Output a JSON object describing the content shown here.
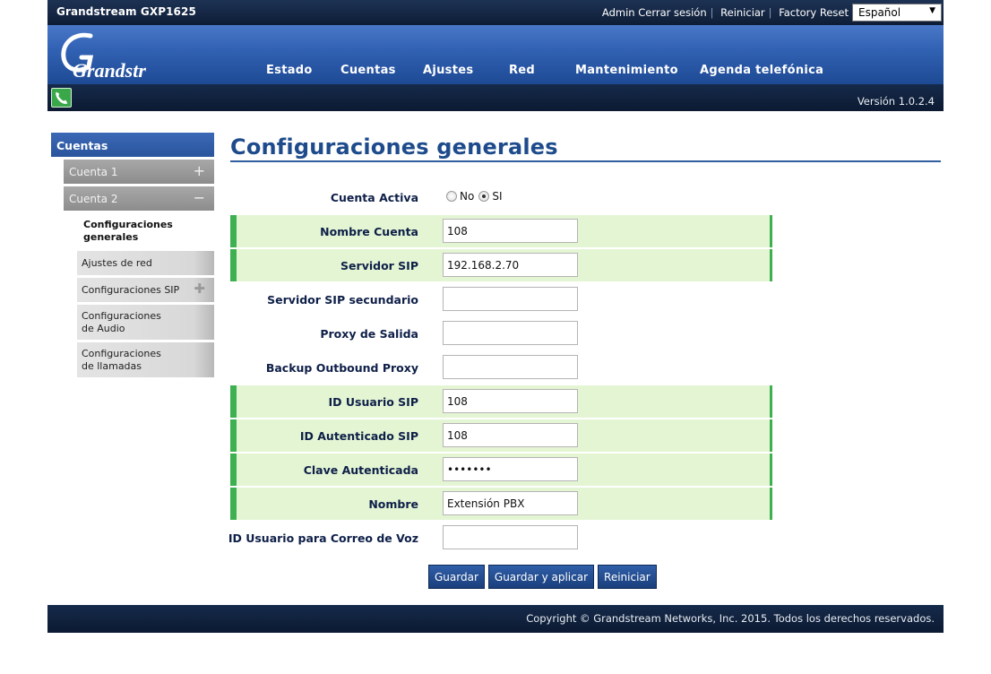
{
  "header": {
    "product": "Grandstream GXP1625",
    "links": [
      "Admin",
      "Cerrar sesión",
      "Reiniciar",
      "Factory Reset"
    ],
    "language": "Español",
    "logo_text": "Grandstream",
    "version": "Versión 1.0.2.4"
  },
  "nav": {
    "items": [
      "Estado",
      "Cuentas",
      "Ajustes",
      "Red",
      "Mantenimiento",
      "Agenda telefónica"
    ]
  },
  "sidebar": {
    "title": "Cuentas",
    "accounts": [
      {
        "label": "Cuenta 1",
        "toggle": "+"
      },
      {
        "label": "Cuenta 2",
        "toggle": "−"
      }
    ],
    "active_item": "Configuraciones generales",
    "items": [
      "Ajustes de red",
      "Configuraciones SIP",
      "Configuraciones de Audio",
      "Configuraciones de llamadas"
    ]
  },
  "page": {
    "title": "Configuraciones generales",
    "cuenta_activa": {
      "label": "Cuenta Activa",
      "options": [
        "No",
        "SI"
      ],
      "selected": "SI"
    },
    "fields": [
      {
        "label": "Nombre Cuenta",
        "value": "108",
        "highlight": true
      },
      {
        "label": "Servidor SIP",
        "value": "192.168.2.70",
        "highlight": true
      },
      {
        "label": "Servidor SIP secundario",
        "value": "",
        "highlight": false
      },
      {
        "label": "Proxy de Salida",
        "value": "",
        "highlight": false
      },
      {
        "label": "Backup Outbound Proxy",
        "value": "",
        "highlight": false
      },
      {
        "label": "ID Usuario SIP",
        "value": "108",
        "highlight": true
      },
      {
        "label": "ID Autenticado SIP",
        "value": "108",
        "highlight": true
      },
      {
        "label": "Clave Autenticada",
        "value": "•••••••",
        "highlight": true
      },
      {
        "label": "Nombre",
        "value": "Extensión PBX",
        "highlight": true
      },
      {
        "label": "ID Usuario para Correo de Voz",
        "value": "",
        "highlight": false
      }
    ],
    "buttons": [
      "Guardar",
      "Guardar y aplicar",
      "Reiniciar"
    ]
  },
  "footer": {
    "copyright": "Copyright © Grandstream Networks, Inc. 2015. Todos los derechos reservados."
  },
  "colors": {
    "accent": "#1e4b8c",
    "highlight_row": "#e4f5d4",
    "highlight_border": "#3fb052",
    "header_dark": "#0e1d36"
  }
}
